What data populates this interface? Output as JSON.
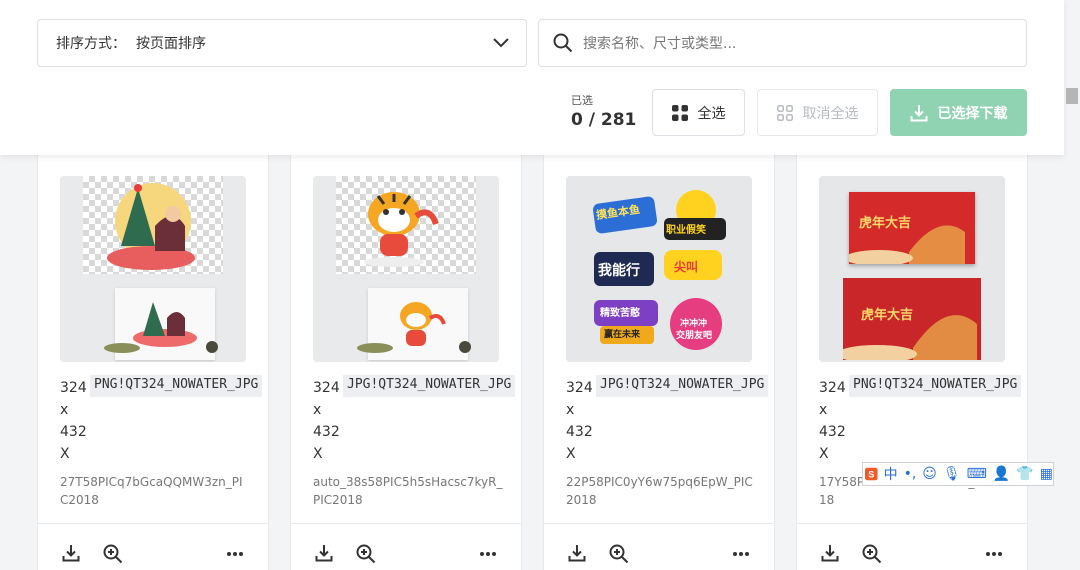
{
  "toolbar": {
    "sort_label": "排序方式：",
    "sort_value": "按页面排序",
    "search_placeholder": "搜索名称、尺寸或类型...",
    "selected_label": "已选",
    "selected_count": "0 / 281",
    "select_all_label": "全选",
    "deselect_all_label": "取消全选",
    "download_selected_label": "已选择下载"
  },
  "cards": [
    {
      "w": "324",
      "x": "x",
      "h": "432",
      "X": "X",
      "tag": "PNG!QT324_NOWATER_JPG",
      "filename": "27T58PICq7bGcaQQMW3zn_PIC2018",
      "theme": "christmas"
    },
    {
      "w": "324",
      "x": "x",
      "h": "432",
      "X": "X",
      "tag": "JPG!QT324_NOWATER_JPG",
      "filename": "auto_38s58PIC5h5sHacsc7kyR_PIC2018",
      "theme": "tiger"
    },
    {
      "w": "324",
      "x": "x",
      "h": "432",
      "X": "X",
      "tag": "JPG!QT324_NOWATER_JPG",
      "filename": "22P58PIC0yY6w75pq6EpW_PIC2018",
      "theme": "stickers"
    },
    {
      "w": "324",
      "x": "x",
      "h": "432",
      "X": "X",
      "tag": "PNG!QT324_NOWATER_JPG",
      "filename": "17Y58PICxxxxxxxxxxxxx_PIC2018",
      "theme": "poster"
    }
  ],
  "sticker_texts": [
    "摸鱼本鱼",
    "职业假笑",
    "我能行",
    "尖叫",
    "精致苦憨",
    "赢在未来",
    "冲冲冲",
    "交朋友吧"
  ],
  "poster_texts": [
    "虎年大吉",
    "虎年大吉"
  ],
  "ime": {
    "label": "中"
  },
  "colors": {
    "accent": "#8fd3b2",
    "border": "#dcdfe3",
    "poster_red": "#d42a2a"
  }
}
